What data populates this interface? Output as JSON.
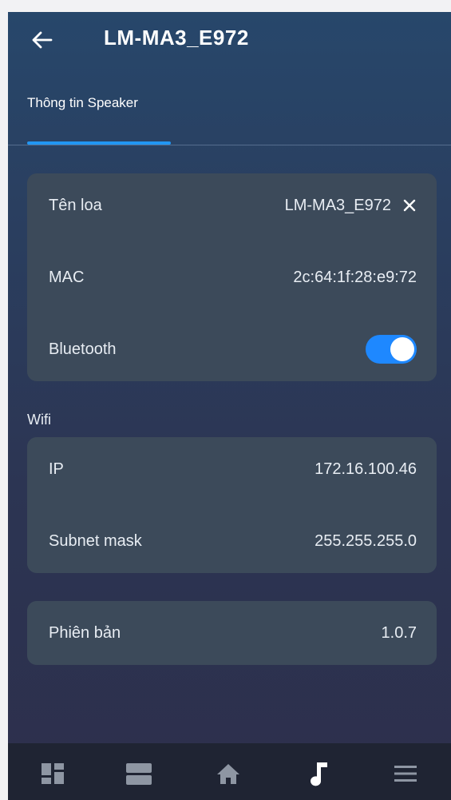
{
  "header": {
    "title": "LM-MA3_E972",
    "back_icon": "arrow-left-icon"
  },
  "tabs": [
    {
      "label": "Thông tin Speaker",
      "active": true
    }
  ],
  "info_card": {
    "rows": [
      {
        "label": "Tên loa",
        "value": "LM-MA3_E972",
        "action_icon": "close-icon"
      },
      {
        "label": "MAC",
        "value": "2c:64:1f:28:e9:72"
      },
      {
        "label": "Bluetooth",
        "toggle_on": true
      }
    ]
  },
  "wifi": {
    "section_label": "Wifi",
    "rows": [
      {
        "label": "IP",
        "value": "172.16.100.46"
      },
      {
        "label": "Subnet mask",
        "value": "255.255.255.0"
      }
    ]
  },
  "version": {
    "label": "Phiên bản",
    "value": "1.0.7"
  },
  "bottom_nav": {
    "items": [
      {
        "icon": "dashboard-icon",
        "active": false
      },
      {
        "icon": "list-view-icon",
        "active": false
      },
      {
        "icon": "home-icon",
        "active": false
      },
      {
        "icon": "music-note-icon",
        "active": true
      },
      {
        "icon": "menu-icon",
        "active": false
      }
    ]
  },
  "colors": {
    "accent": "#2196f3",
    "card": "#3c4a5a",
    "toggle_on": "#1e88ff",
    "nav_bg": "#1f2433",
    "nav_inactive": "#8e96a3",
    "nav_active": "#ffffff"
  }
}
